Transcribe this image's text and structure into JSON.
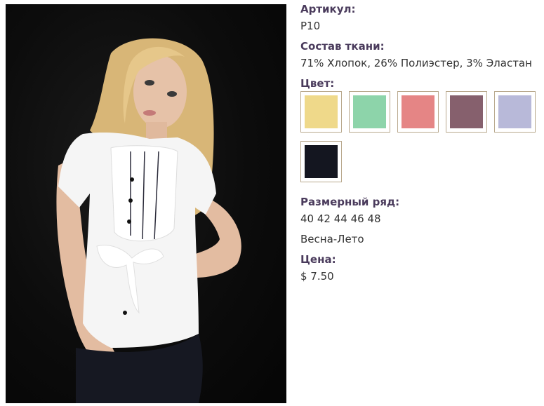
{
  "product": {
    "article_label": "Артикул:",
    "article_value": "P10",
    "fabric_label": "Состав ткани:",
    "fabric_value": "71% Хлопок, 26% Полиэстер, 3% Эластан",
    "color_label": "Цвет:",
    "swatches": [
      {
        "name": "yellow",
        "color": "#efd98a"
      },
      {
        "name": "mint",
        "color": "#8dd4aa"
      },
      {
        "name": "pink",
        "color": "#e58585"
      },
      {
        "name": "mauve",
        "color": "#86606d"
      },
      {
        "name": "lavender",
        "color": "#b8b9d9"
      },
      {
        "name": "black",
        "color": "#141620"
      }
    ],
    "sizes_label": "Размерный ряд:",
    "sizes_value": "40 42 44 46 48",
    "season_value": "Весна-Лето",
    "price_label": "Цена:",
    "price_value": "$ 7.50"
  },
  "colors": {
    "label": "#4a3b5c",
    "text": "#333333",
    "swatch_border": "#b9a98e"
  }
}
